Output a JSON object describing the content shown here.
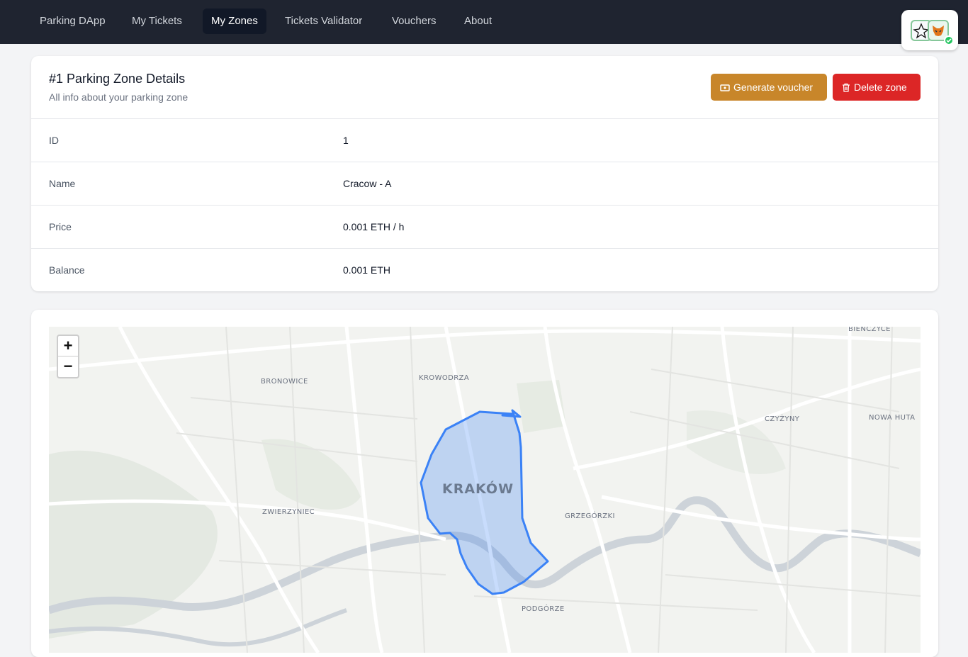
{
  "nav": {
    "items": [
      {
        "label": "Parking DApp"
      },
      {
        "label": "My Tickets"
      },
      {
        "label": "My Zones"
      },
      {
        "label": "Tickets Validator"
      },
      {
        "label": "Vouchers"
      },
      {
        "label": "About"
      }
    ],
    "active": "My Zones"
  },
  "zone": {
    "title": "#1 Parking Zone Details",
    "subtitle": "All info about your parking zone",
    "generate_voucher_label": "Generate voucher",
    "delete_zone_label": "Delete zone",
    "rows": [
      {
        "label": "ID",
        "value": "1"
      },
      {
        "label": "Name",
        "value": "Cracow - A"
      },
      {
        "label": "Price",
        "value": "0.001 ETH / h"
      },
      {
        "label": "Balance",
        "value": "0.001 ETH"
      }
    ]
  },
  "map": {
    "zoom_in": "+",
    "zoom_out": "−",
    "city_label": "KRAKÓW",
    "district_labels": [
      "BIENCZYCE",
      "BRONOWICE",
      "KROWODRZA",
      "CZYŻYNY",
      "NOWA HUTA",
      "ZWIERZYNIEC",
      "GRZEGÓRZKI",
      "PODGÓRZE"
    ],
    "zone_fill_color": "#3b82f6"
  },
  "colors": {
    "nav_bg": "#1f2430",
    "voucher_button": "#c8862a",
    "delete_button": "#dc2626"
  }
}
